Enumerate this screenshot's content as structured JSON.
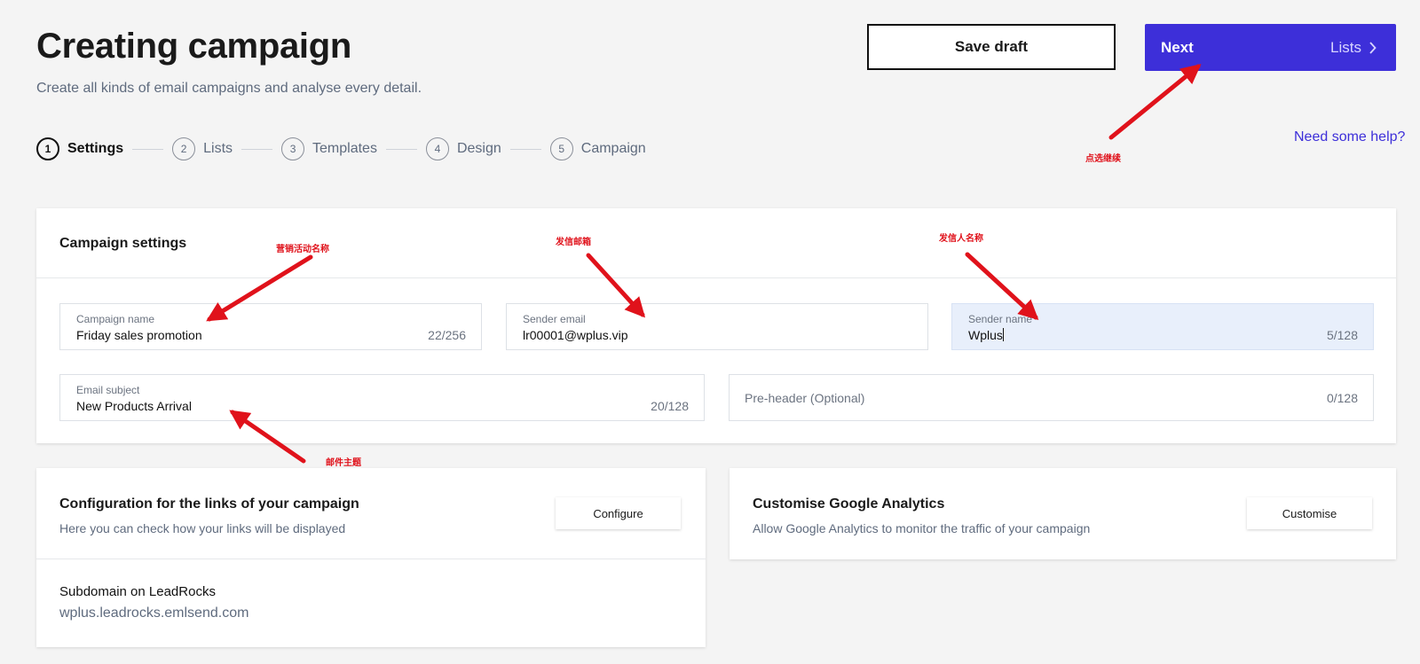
{
  "header": {
    "title": "Creating campaign",
    "subtitle": "Create all kinds of email campaigns and analyse every detail.",
    "save_draft_label": "Save draft",
    "next_label": "Next",
    "next_step_label": "Lists",
    "help_link": "Need some help?"
  },
  "steps": [
    {
      "num": "1",
      "label": "Settings",
      "active": true
    },
    {
      "num": "2",
      "label": "Lists",
      "active": false
    },
    {
      "num": "3",
      "label": "Templates",
      "active": false
    },
    {
      "num": "4",
      "label": "Design",
      "active": false
    },
    {
      "num": "5",
      "label": "Campaign",
      "active": false
    }
  ],
  "campaign_settings": {
    "title": "Campaign settings",
    "fields": {
      "campaign_name": {
        "label": "Campaign name",
        "value": "Friday sales promotion",
        "count": "22/256"
      },
      "sender_email": {
        "label": "Sender email",
        "value": "lr00001@wplus.vip"
      },
      "sender_name": {
        "label": "Sender name",
        "value": "Wplus",
        "count": "5/128"
      },
      "email_subject": {
        "label": "Email subject",
        "value": "New Products Arrival",
        "count": "20/128"
      },
      "pre_header": {
        "placeholder": "Pre-header (Optional)",
        "count": "0/128"
      }
    }
  },
  "links_config": {
    "title": "Configuration for the links of your campaign",
    "description": "Here you can check how your links will be displayed",
    "button_label": "Configure",
    "subdomain_label": "Subdomain on LeadRocks",
    "subdomain_value": "wplus.leadrocks.emlsend.com"
  },
  "google_analytics": {
    "title": "Customise Google Analytics",
    "description": "Allow Google Analytics to monitor the traffic of your campaign",
    "button_label": "Customise"
  },
  "annotations": {
    "campaign_name": "营销活动名称",
    "sender_email": "发信邮箱",
    "sender_name": "发信人名称",
    "email_subject": "邮件主题",
    "next": "点选继续"
  },
  "colors": {
    "accent": "#3d2fd9",
    "annotation": "#e0121b",
    "background": "#f4f4f4",
    "focused_field": "#e8effb"
  }
}
